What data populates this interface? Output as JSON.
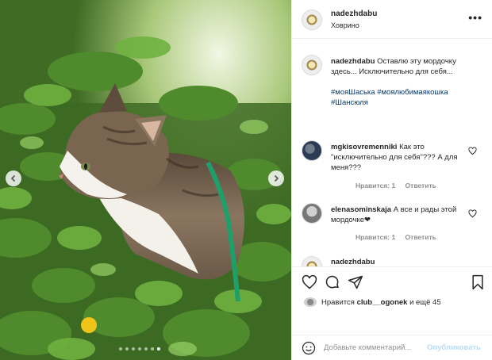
{
  "post": {
    "author": "nadezhdabu",
    "location": "Ховрино",
    "more_icon": "more-horizontal-icon",
    "caption": {
      "username": "nadezhdabu",
      "text": "Оставлю эту мордочку здесь... Исключительно для себя...",
      "hashtags": "#мояШаська #моялюбимаякошка #Шансюля"
    },
    "comments": [
      {
        "username": "mgkisovremenniki",
        "text": "Как это \"исключительно для себя\"??? А для меня???",
        "likes": "Нравится: 1",
        "reply": "Ответить"
      },
      {
        "username": "elenasominskaja",
        "text": "А все и рады этой мордочке❤",
        "likes": "Нравится: 1",
        "reply": "Ответить"
      },
      {
        "username": "nadezhdabu",
        "text": ""
      }
    ],
    "likes_line": {
      "prefix": "Нравится",
      "user": "club__ogonek",
      "suffix": "и ещё 45"
    },
    "comment_box": {
      "placeholder": "Добавьте комментарий...",
      "publish": "Опубликовать"
    }
  },
  "carousel": {
    "total_slides": 7,
    "active_slide": 7
  },
  "colors": {
    "link": "#00376b",
    "muted": "#8e8e8e",
    "publish_disabled": "#b2dffc"
  }
}
